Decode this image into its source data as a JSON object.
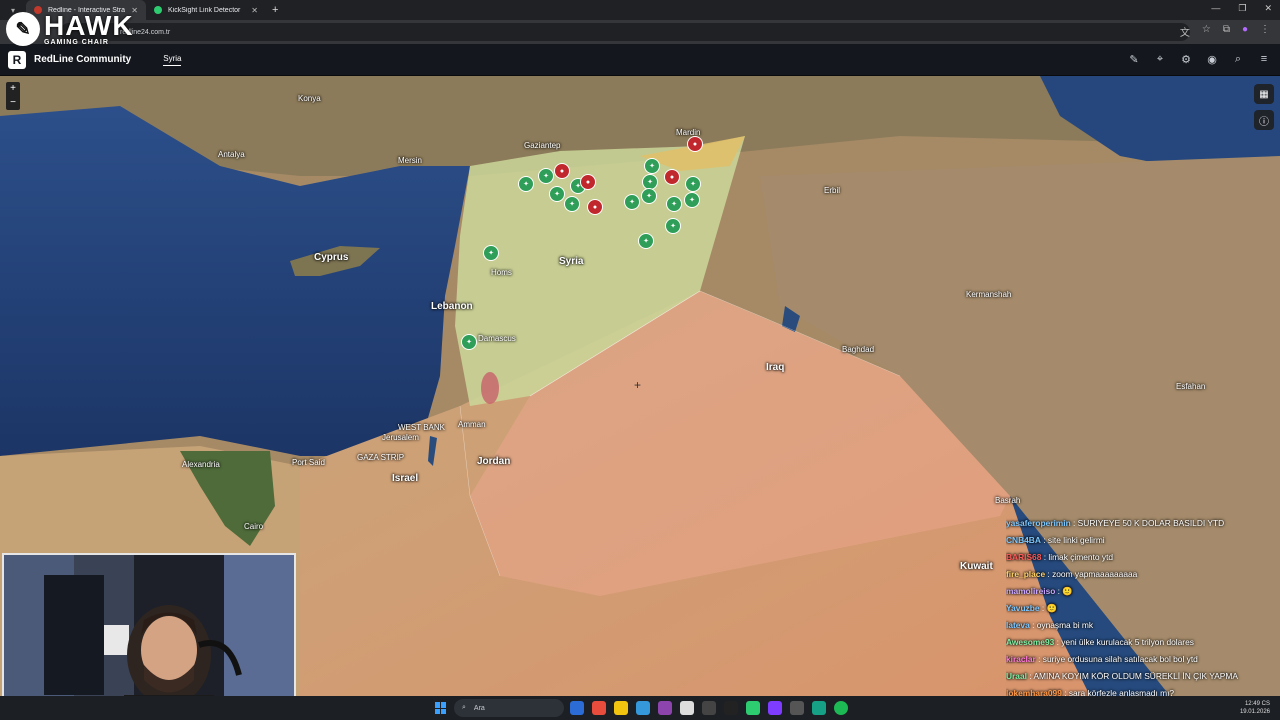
{
  "browser": {
    "tabs": [
      {
        "label": "Redline - Interactive Strategic M",
        "active": true
      },
      {
        "label": "KickSight Link Detector",
        "active": false
      }
    ],
    "url": "redline24.com.tr"
  },
  "overlay": {
    "brand": "HAWK",
    "sub": "GAMING CHAIR"
  },
  "app": {
    "name": "RedLine Community",
    "nav_tab": "Syria"
  },
  "map": {
    "labels": {
      "cyprus": "Cyprus",
      "lebanon": "Lebanon",
      "syria": "Syria",
      "iraq": "Iraq",
      "jordan": "Jordan",
      "israel": "Israel",
      "kuwait": "Kuwait",
      "west_bank": "WEST BANK",
      "gaza": "GAZA STRIP",
      "jerusalem": "Jerusalem",
      "amman": "Amman",
      "baghdad": "Baghdad",
      "alexandria": "Alexandria",
      "antalya": "Antalya",
      "konya": "Konya",
      "mersin": "Mersin",
      "gaziantep": "Gaziantep",
      "damascus": "Damascus",
      "homs": "Homs",
      "erbil": "Erbil",
      "basrah": "Basrah",
      "cairo": "Cairo",
      "port_said": "Port Said",
      "isfahan": "Esfahan",
      "kermanshah": "Kermanshah",
      "mardin": "Mardin"
    },
    "zoom_in": "+",
    "zoom_out": "−"
  },
  "chat": [
    {
      "user": "yasaferoperimin",
      "text": ": SURIYEYE 50 K DOLAR BASILDI YTD",
      "color": "#7ec8ff"
    },
    {
      "user": "CNB4BA",
      "text": ": site linki gelirmi",
      "color": "#7ec8ff"
    },
    {
      "user": "BARIS68",
      "text": ": limak çimento ytd",
      "color": "#ff5a5a"
    },
    {
      "user": "fire_place",
      "text": ": zoom yapmaaaaaaaaa",
      "color": "#ffd36a"
    },
    {
      "user": "mamolireiso",
      "text": ": 🙂",
      "color": "#c7a6ff"
    },
    {
      "user": "Yavuzbe",
      "text": ": 🙂",
      "color": "#7ec8ff"
    },
    {
      "user": "lateva",
      "text": ": oynaşma bi mk",
      "color": "#7ec8ff"
    },
    {
      "user": "Awesome93",
      "text": ": yeni ülke kurulacak 5 trilyon dolares",
      "color": "#7ef0a6"
    },
    {
      "user": "kiraclar",
      "text": ": suriye ordusuna silah satılacak bol bol ytd",
      "color": "#ff7ad9"
    },
    {
      "user": "Uraal",
      "text": ": AMINA KOYIM KÖR OLDUM SÜREKLİ İN ÇIK YAPMA",
      "color": "#7ef0a6"
    },
    {
      "user": "lokemhara099",
      "text": ": şara körfezle anlaşmadı mı?",
      "color": "#ff9a4a"
    }
  ],
  "taskbar": {
    "search_placeholder": "Ara",
    "time": "12:49 CS",
    "date": "19.01.2026"
  }
}
